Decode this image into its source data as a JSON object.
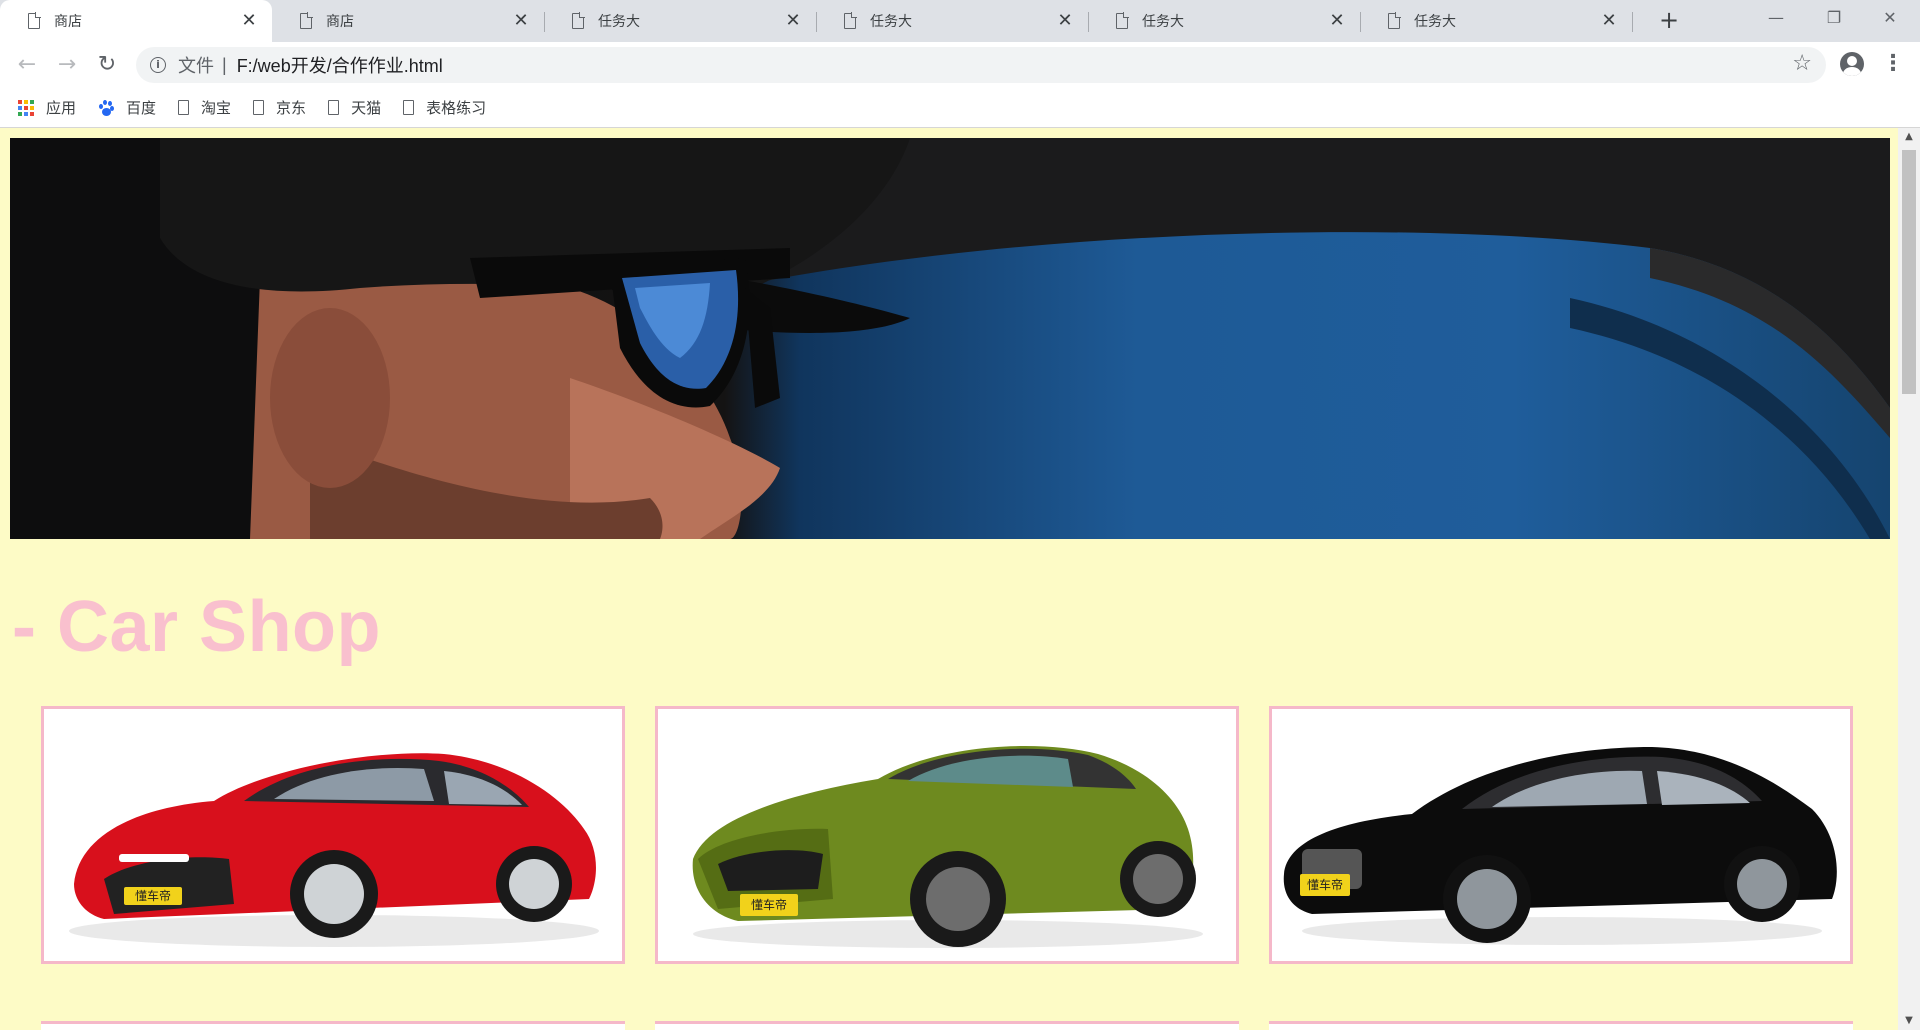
{
  "browser": {
    "tabs": [
      {
        "title": "商店",
        "active": true
      },
      {
        "title": "商店",
        "active": false
      },
      {
        "title": "任务大",
        "active": false
      },
      {
        "title": "任务大",
        "active": false
      },
      {
        "title": "任务大",
        "active": false
      },
      {
        "title": "任务大",
        "active": false
      }
    ],
    "close_glyph": "✕",
    "new_tab_glyph": "+",
    "window_controls": {
      "minimize": "—",
      "restore": "❐",
      "close": "✕"
    },
    "nav": {
      "back": "←",
      "forward": "→",
      "reload": "↻"
    },
    "omnibox": {
      "info_glyph": "i",
      "scheme_label": "文件",
      "separator": "|",
      "url": "F:/web开发/合作作业.html",
      "star_glyph": "☆"
    },
    "menu_glyph": "⋮",
    "bookmarks": [
      {
        "label": "应用",
        "icon": "apps-grid-icon"
      },
      {
        "label": "百度",
        "icon": "baidu-paw-icon"
      },
      {
        "label": "淘宝",
        "icon": "document-icon"
      },
      {
        "label": "京东",
        "icon": "document-icon"
      },
      {
        "label": "天猫",
        "icon": "document-icon"
      },
      {
        "label": "表格练习",
        "icon": "document-icon"
      }
    ]
  },
  "page": {
    "background": "#fdfbc6",
    "accent": "#f9c0ce",
    "card_border": "#f5b8c9",
    "title": "- Car Shop",
    "cars": [
      {
        "name": "red-sedan",
        "color": "#d8101c",
        "plate": "懂车帝"
      },
      {
        "name": "green-coupe",
        "color": "#6e8a1f",
        "plate": "懂车帝"
      },
      {
        "name": "black-sedan",
        "color": "#0c0c0c",
        "plate": "懂车帝"
      }
    ]
  },
  "scrollbar": {
    "up": "▲",
    "down": "▼"
  }
}
